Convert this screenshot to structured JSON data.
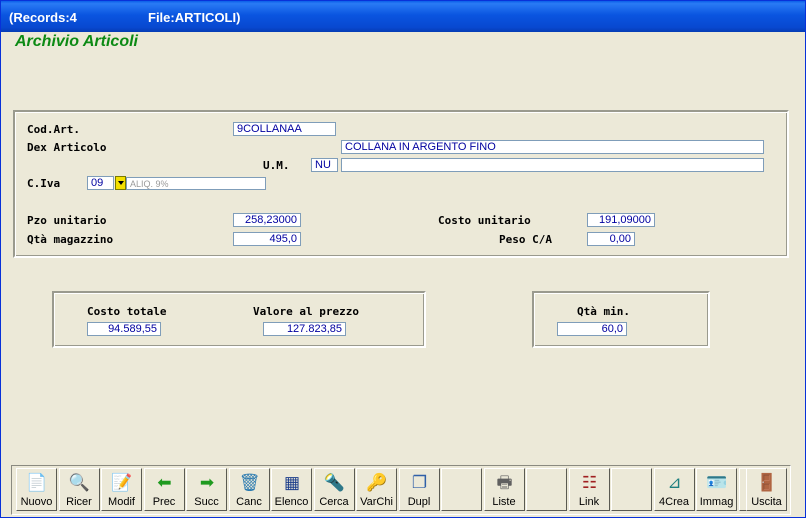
{
  "window": {
    "records": "(Records:4",
    "file": "File:ARTICOLI)"
  },
  "app_title": "Archivio Articoli",
  "form": {
    "cod_art": {
      "label": "Cod.Art.",
      "value": "9COLLANAA"
    },
    "dex": {
      "label": "Dex Articolo",
      "value": "COLLANA IN ARGENTO FINO"
    },
    "um": {
      "label": "U.M.",
      "value": "NU",
      "extra": ""
    },
    "civa": {
      "label": "C.Iva",
      "value": "09",
      "desc": "ALIQ. 9%"
    },
    "pzo": {
      "label": "Pzo unitario",
      "value": "258,23000"
    },
    "costo_unit": {
      "label": "Costo unitario",
      "value": "191,09000"
    },
    "qta_mag": {
      "label": "Qtà magazzino",
      "value": "495,0"
    },
    "peso": {
      "label": "Peso C/A",
      "value": "0,00"
    }
  },
  "totals": {
    "costo_totale": {
      "label": "Costo totale",
      "value": "94.589,55"
    },
    "valore": {
      "label": "Valore al prezzo",
      "value": "127.823,85"
    },
    "qta_min": {
      "label": "Qtà min.",
      "value": "60,0"
    }
  },
  "toolbar": [
    {
      "label": "Nuovo",
      "icon": "new-doc-icon",
      "color": "#2ea82e"
    },
    {
      "label": "Ricer",
      "icon": "magnifier-icon",
      "color": "#3060a8"
    },
    {
      "label": "Modif",
      "icon": "edit-doc-icon",
      "color": "#3060a8"
    },
    {
      "label": "Prec",
      "icon": "arrow-left-icon",
      "color": "#1f9a1f"
    },
    {
      "label": "Succ",
      "icon": "arrow-right-icon",
      "color": "#1f9a1f"
    },
    {
      "label": "Canc",
      "icon": "trash-icon",
      "color": "#2a7ab0"
    },
    {
      "label": "Elenco",
      "icon": "table-icon",
      "color": "#1a3c8a"
    },
    {
      "label": "Cerca",
      "icon": "flashlight-icon",
      "color": "#c07a10"
    },
    {
      "label": "VarChi",
      "icon": "keys-icon",
      "color": "#a08020"
    },
    {
      "label": "Dupl",
      "icon": "copy-icon",
      "color": "#3060a8"
    },
    {
      "label": "",
      "icon": "empty-icon",
      "color": ""
    },
    {
      "label": "Liste",
      "icon": "printer-icon",
      "color": "#606060"
    },
    {
      "label": "",
      "icon": "empty-icon",
      "color": ""
    },
    {
      "label": "Link",
      "icon": "tree-icon",
      "color": "#a02020"
    },
    {
      "label": "",
      "icon": "empty-icon",
      "color": ""
    },
    {
      "label": "4Crea",
      "icon": "design-icon",
      "color": "#208080"
    },
    {
      "label": "Immag",
      "icon": "id-card-icon",
      "color": "#3060a8"
    },
    {
      "label": "",
      "icon": "empty-icon",
      "color": ""
    },
    {
      "label": "Uscita",
      "icon": "exit-door-icon",
      "color": "#c01010"
    }
  ]
}
